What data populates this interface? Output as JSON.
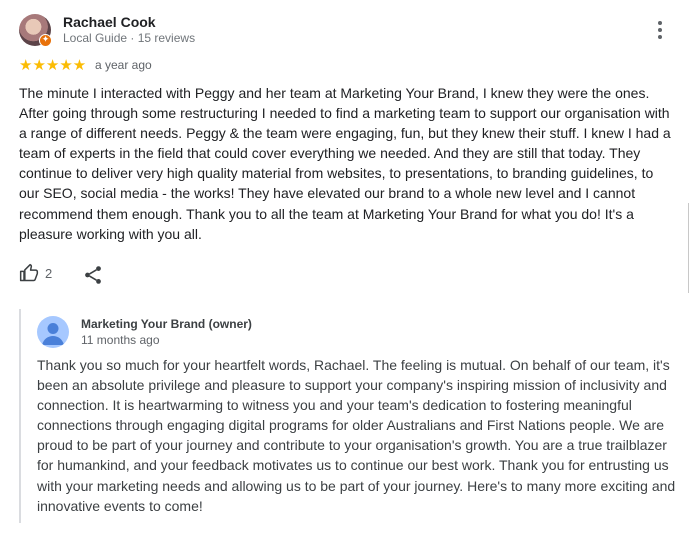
{
  "review": {
    "reviewer_name": "Rachael Cook",
    "reviewer_meta": "Local Guide · 15 reviews",
    "rating": 5,
    "stars": "★★★★★",
    "date": "a year ago",
    "text": "The minute I interacted with Peggy and her team at Marketing Your Brand, I knew they were the ones. After going through some restructuring I needed to find a marketing team to support our organisation with a range of different needs. Peggy & the team were engaging, fun, but they knew their stuff. I knew I had a team of experts in the field that could cover everything we needed. And they are still that today. They continue to deliver very high quality material from websites, to presentations, to branding guidelines, to our SEO, social media - the works! They have elevated our brand to a whole new level and I cannot recommend them enough. Thank you to all the team at Marketing Your Brand for what you do! It's a pleasure working with you all.",
    "like_count": "2",
    "icons": {
      "like": "thumb-up-icon",
      "share": "share-icon",
      "more": "more-vert-icon",
      "badge": "local-guide-badge-icon"
    },
    "colors": {
      "stars": "#fbbc04",
      "badge": "#e8710a"
    }
  },
  "owner_reply": {
    "name": "Marketing Your Brand (owner)",
    "date": "11 months ago",
    "text": "Thank you so much for your heartfelt words, Rachael. The feeling is mutual. On behalf of our team, it's been an absolute privilege and pleasure to support your company's inspiring mission of inclusivity and connection. It is heartwarming to witness you and your team's dedication to fostering meaningful connections through engaging digital programs for older Australians and First Nations people. We are proud to be part of your journey and contribute to your organisation's growth. You are a true trailblazer for humankind, and your feedback motivates us to continue our best work. Thank you for entrusting us with your marketing needs and allowing us to be part of your journey. Here's to many more exciting and innovative events to come!",
    "icons": {
      "avatar": "default-person-avatar-icon"
    }
  }
}
